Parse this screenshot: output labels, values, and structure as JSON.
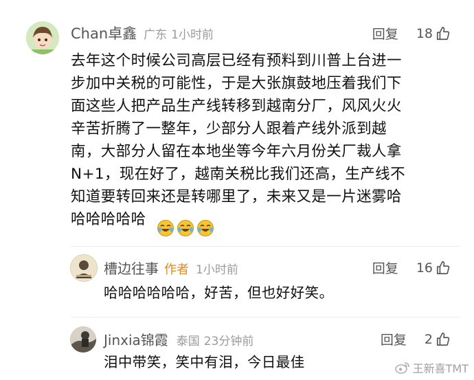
{
  "comments": [
    {
      "username": "Chan卓鑫",
      "region": "广东",
      "time": "1小时前",
      "reply_label": "回复",
      "likes": "18",
      "text": "去年这个时候公司高层已经有预料到川普上台进一\n步加中关税的可能性，于是大张旗鼓地压着我们下\n面这些人把产品生产线转移到越南分厂，风风火火\n辛苦折腾了一整年，少部分人跟着产线外派到越\n南，大部分人留在本地坐等今年六月份关厂裁人拿\nN+1，现在好了，越南关税比我们还高，生产线不\n知道要转回来还是转哪里了，未来又是一片迷雾哈\n哈哈哈哈哈",
      "emojis": [
        "laugh-cry-emoji",
        "laugh-cry-emoji",
        "laugh-cry-emoji"
      ]
    },
    {
      "username": "槽边往事",
      "author_tag": "作者",
      "time": "1小时前",
      "reply_label": "回复",
      "likes": "16",
      "text": "哈哈哈哈哈哈，好苦，但也好好笑。"
    },
    {
      "username": "Jinxia锦霞",
      "region": "泰国",
      "time": "23分钟前",
      "reply_label": "回复",
      "likes": "2",
      "text": "泪中带笑，笑中有泪，今日最佳"
    }
  ],
  "watermark": "王新喜TMT",
  "colors": {
    "username": "#555555",
    "author_tag": "#e08a1c",
    "meta": "#9b9b9b",
    "text": "#111111"
  }
}
